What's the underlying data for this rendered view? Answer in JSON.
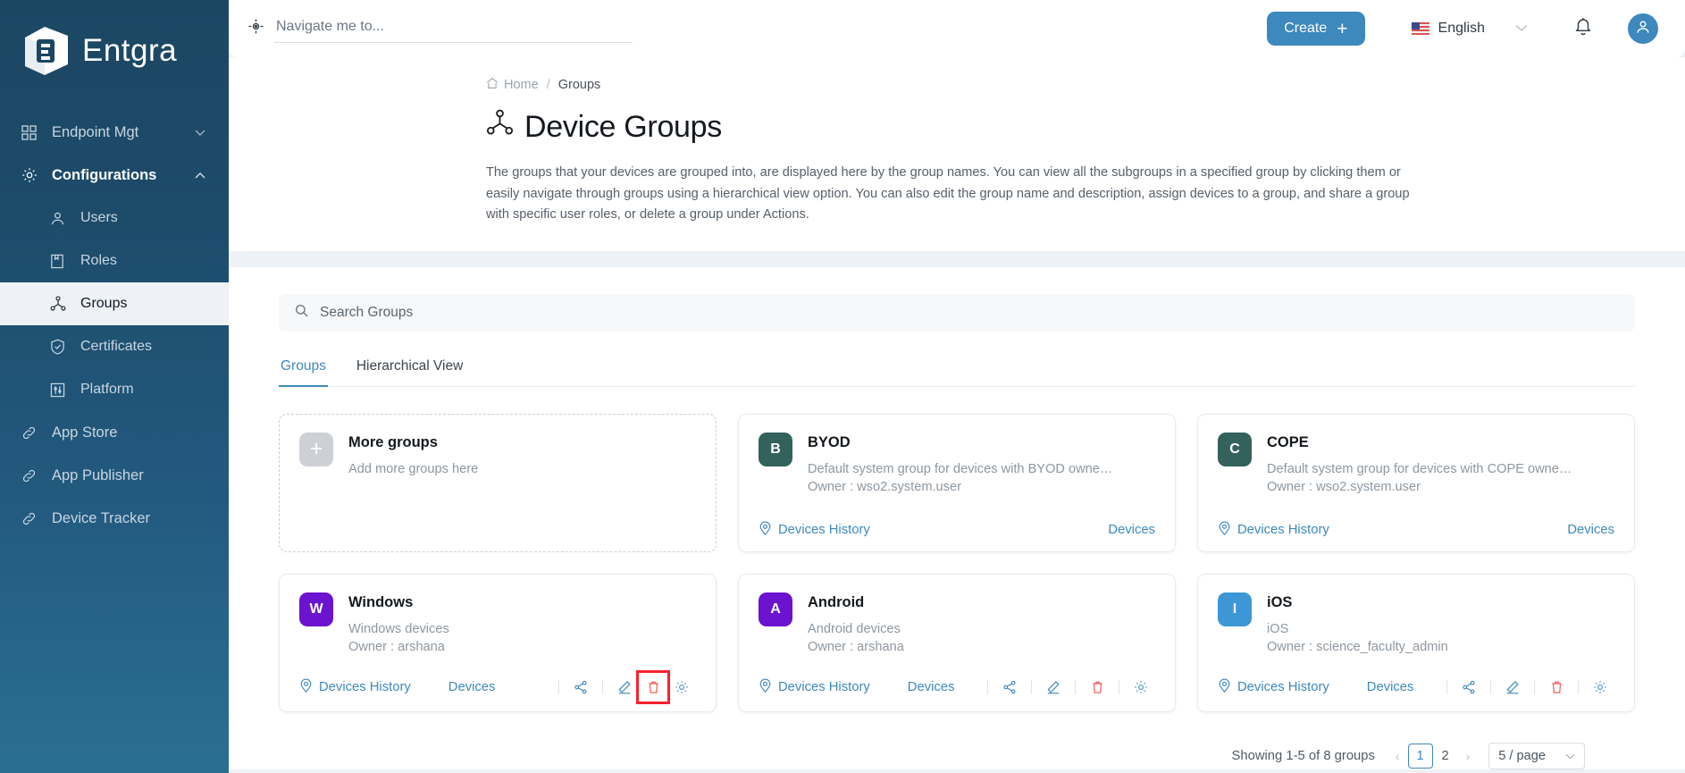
{
  "brand": {
    "name": "Entgra",
    "logo_icon": "entgra-logo-icon"
  },
  "sidebar": {
    "items": [
      {
        "label": "Endpoint Mgt",
        "icon": "grid-icon",
        "chevron": "chevron-down-icon",
        "level": "top",
        "state": "collapsed"
      },
      {
        "label": "Configurations",
        "icon": "gear-icon",
        "chevron": "chevron-up-icon",
        "level": "top",
        "state": "expanded"
      },
      {
        "label": "Users",
        "icon": "user-icon",
        "level": "sub",
        "state": "normal"
      },
      {
        "label": "Roles",
        "icon": "book-icon",
        "level": "sub",
        "state": "normal"
      },
      {
        "label": "Groups",
        "icon": "groups-icon",
        "level": "sub",
        "state": "active"
      },
      {
        "label": "Certificates",
        "icon": "shield-check-icon",
        "level": "sub",
        "state": "normal"
      },
      {
        "label": "Platform",
        "icon": "sliders-icon",
        "level": "sub",
        "state": "normal"
      },
      {
        "label": "App Store",
        "icon": "link-icon",
        "level": "top",
        "state": "normal"
      },
      {
        "label": "App Publisher",
        "icon": "link-icon",
        "level": "top",
        "state": "normal"
      },
      {
        "label": "Device Tracker",
        "icon": "link-icon",
        "level": "top",
        "state": "normal"
      }
    ]
  },
  "topbar": {
    "navigate_placeholder": "Navigate me to...",
    "navigate_value": "",
    "navigate_icon": "location-target-icon",
    "create_label": "Create",
    "create_plus": "+",
    "language": "English",
    "language_flag": "us-flag-icon",
    "language_caret": "chevron-down-icon",
    "notifications_icon": "bell-icon",
    "avatar_icon": "user-avatar-icon"
  },
  "breadcrumb": {
    "home": "Home",
    "separator": "/",
    "current": "Groups",
    "home_icon": "home-icon"
  },
  "page": {
    "title": "Device Groups",
    "title_icon": "groups-icon",
    "description": "The groups that your devices are grouped into, are displayed here by the group names. You can view all the subgroups in a specified group by clicking them or easily navigate through groups using a hierarchical view option. You can also edit the group name and description, assign devices to a group, and share a group with specific user roles, or delete a group under Actions."
  },
  "search": {
    "placeholder": "Search Groups",
    "value": "",
    "icon": "search-icon"
  },
  "tabs": [
    {
      "label": "Groups",
      "active": true
    },
    {
      "label": "Hierarchical View",
      "active": false
    }
  ],
  "add_card": {
    "title": "More groups",
    "subtitle": "Add more groups here",
    "icon": "plus-icon"
  },
  "action_labels": {
    "devices_history": "Devices History",
    "devices": "Devices",
    "history_icon": "location-pin-icon",
    "share_icon": "share-icon",
    "edit_icon": "pencil-icon",
    "delete_icon": "trash-icon",
    "settings_icon": "gear-icon"
  },
  "colors": {
    "accent": "#3d88bd",
    "sidebar_top": "#1b4763",
    "sidebar_bottom": "#2b6e94",
    "badge_teal": "#34615c",
    "badge_purple": "#6b13cf",
    "badge_blue": "#3d97d6",
    "badge_gray": "#cdd1d6",
    "delete_red": "#f5504e",
    "highlight_red": "#f5222d"
  },
  "groups": [
    {
      "initial": "B",
      "name": "BYOD",
      "description": "Default system group for devices with BYOD owne…",
      "owner": "Owner : wso2.system.user",
      "badge_color": "#34615c",
      "show_icons": false,
      "highlight_delete": false
    },
    {
      "initial": "C",
      "name": "COPE",
      "description": "Default system group for devices with COPE owne…",
      "owner": "Owner : wso2.system.user",
      "badge_color": "#34615c",
      "show_icons": false,
      "highlight_delete": false
    },
    {
      "initial": "W",
      "name": "Windows",
      "description": "Windows devices",
      "owner": "Owner : arshana",
      "badge_color": "#6b13cf",
      "show_icons": true,
      "highlight_delete": true
    },
    {
      "initial": "A",
      "name": "Android",
      "description": "Android devices",
      "owner": "Owner : arshana",
      "badge_color": "#6b13cf",
      "show_icons": true,
      "highlight_delete": false
    },
    {
      "initial": "I",
      "name": "iOS",
      "description": "iOS",
      "owner": "Owner : science_faculty_admin",
      "badge_color": "#3d97d6",
      "show_icons": true,
      "highlight_delete": false
    }
  ],
  "pagination": {
    "summary": "Showing 1-5 of 8 groups",
    "prev": "‹",
    "next": "›",
    "pages": [
      "1",
      "2"
    ],
    "current_page": "1",
    "page_size": "5 / page",
    "page_size_caret": "chevron-down-icon"
  }
}
